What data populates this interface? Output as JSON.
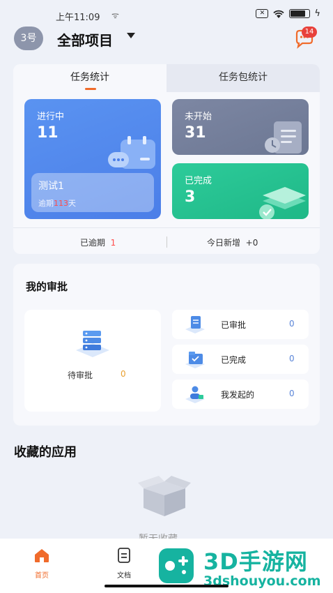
{
  "status_bar": {
    "time": "上午11:09"
  },
  "header": {
    "avatar_text": "3号",
    "project_title": "全部项目",
    "message_badge": "14"
  },
  "task_stats": {
    "tabs": [
      {
        "label": "任务统计",
        "active": true
      },
      {
        "label": "任务包统计",
        "active": false
      }
    ],
    "in_progress": {
      "label": "进行中",
      "value": "11"
    },
    "not_started": {
      "label": "未开始",
      "value": "31"
    },
    "completed": {
      "label": "已完成",
      "value": "3"
    },
    "overdue_task": {
      "title": "测试1",
      "overdue_prefix": "逾期",
      "overdue_days": "113",
      "overdue_suffix": "天"
    },
    "summary": {
      "overdue_label": "已逾期",
      "overdue_value": "1",
      "today_new_label": "今日新增",
      "today_new_value": "+0"
    }
  },
  "approvals": {
    "title": "我的审批",
    "pending": {
      "label": "待审批",
      "count": "0"
    },
    "rows": [
      {
        "label": "已审批",
        "count": "0"
      },
      {
        "label": "已完成",
        "count": "0"
      },
      {
        "label": "我发起的",
        "count": "0"
      }
    ]
  },
  "favorites": {
    "title": "收藏的应用",
    "empty_text": "暂无收藏"
  },
  "tabbar": {
    "items": [
      {
        "label": "首页"
      },
      {
        "label": "文档"
      }
    ]
  },
  "watermark": {
    "main": "3D手游网",
    "sub": "3dshouyou.com"
  },
  "colors": {
    "accent": "#f06b2b",
    "in_progress": "#5a93f1",
    "not_started": "#7d87a3",
    "completed": "#2dcb9a",
    "badge": "#e8413b"
  }
}
